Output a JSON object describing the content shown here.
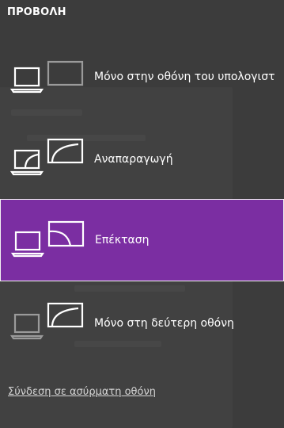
{
  "title": "ΠΡΟΒΟΛΗ",
  "options": [
    {
      "label": "Μόνο στην οθόνη του υπολογιστ",
      "icon": "pc-screen-only-icon",
      "selected": false
    },
    {
      "label": "Αναπαραγωγή",
      "icon": "duplicate-icon",
      "selected": false
    },
    {
      "label": "Επέκταση",
      "icon": "extend-icon",
      "selected": true
    },
    {
      "label": "Μόνο στη δεύτερη οθόνη",
      "icon": "second-screen-only-icon",
      "selected": false
    }
  ],
  "wireless_link": "Σύνδεση σε ασύρματη οθόνη",
  "colors": {
    "accent": "#7b2ea2",
    "background": "#3c3c3c"
  }
}
